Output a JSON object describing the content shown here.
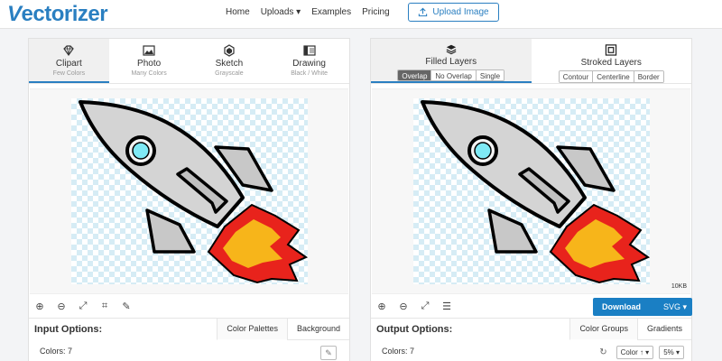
{
  "header": {
    "logo_text": "ectorizer",
    "nav": [
      "Home",
      "Uploads ▾",
      "Examples",
      "Pricing"
    ],
    "upload_label": "Upload Image"
  },
  "left": {
    "modes": [
      {
        "title": "Clipart",
        "sub": "Few Colors",
        "icon": "diamond-icon"
      },
      {
        "title": "Photo",
        "sub": "Many Colors",
        "icon": "image-icon"
      },
      {
        "title": "Sketch",
        "sub": "Grayscale",
        "icon": "sketch-icon"
      },
      {
        "title": "Drawing",
        "sub": "Black / White",
        "icon": "drawing-icon"
      }
    ],
    "options_title": "Input Options:",
    "options_tabs": [
      "Color Palettes",
      "Background"
    ],
    "colors_label": "Colors: 7"
  },
  "right": {
    "layer_tabs": [
      {
        "title": "Filled Layers",
        "opts": [
          "Overlap",
          "No Overlap",
          "Single"
        ]
      },
      {
        "title": "Stroked Layers",
        "opts": [
          "Contour",
          "Centerline",
          "Border"
        ]
      }
    ],
    "size": "10KB",
    "download_label": "Download",
    "download_format": "SVG ▾",
    "options_title": "Output Options:",
    "options_tabs": [
      "Color Groups",
      "Gradients"
    ],
    "colors_label": "Colors: 7",
    "sort_select": "Color ↑ ▾",
    "percent_select": "5% ▾"
  },
  "colors": {
    "accent": "#2a7fc1",
    "rocket_body": "#d4d4d4",
    "window": "#7fe9f5",
    "flame_red": "#e8231c",
    "flame_yellow": "#f7b51a"
  }
}
